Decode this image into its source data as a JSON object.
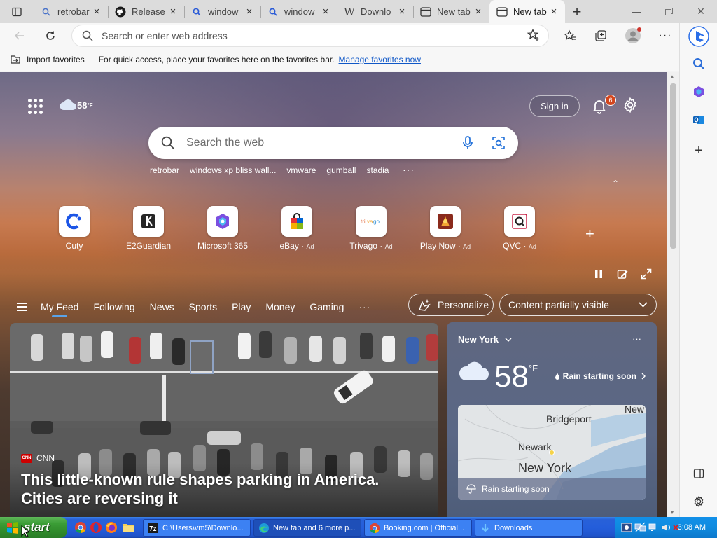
{
  "tabs": [
    {
      "title": "retrobar",
      "icon": "search-icon"
    },
    {
      "title": "Release",
      "icon": "github-icon"
    },
    {
      "title": "window",
      "icon": "search-icon"
    },
    {
      "title": "window",
      "icon": "search-icon"
    },
    {
      "title": "Downlo",
      "icon": "wikipedia-icon"
    },
    {
      "title": "New tab",
      "icon": "newtab-icon"
    },
    {
      "title": "New tab",
      "icon": "newtab-icon",
      "active": true
    }
  ],
  "address": {
    "placeholder": "Search or enter web address"
  },
  "favorites_bar": {
    "import_label": "Import favorites",
    "message": "For quick access, place your favorites here on the favorites bar.",
    "manage_link": "Manage favorites now"
  },
  "top": {
    "weather_temp": "58",
    "weather_unit": "°F",
    "sign_in": "Sign in",
    "notification_count": "6"
  },
  "search": {
    "placeholder": "Search the web",
    "suggestions": [
      "retrobar",
      "windows xp bliss wall...",
      "vmware",
      "gumball",
      "stadia"
    ]
  },
  "quick_links": [
    {
      "name": "Cuty",
      "ad": ""
    },
    {
      "name": "E2Guardian",
      "ad": ""
    },
    {
      "name": "Microsoft 365",
      "ad": ""
    },
    {
      "name": "eBay",
      "ad": "Ad"
    },
    {
      "name": "Trivago",
      "ad": "Ad"
    },
    {
      "name": "Play Now",
      "ad": "Ad"
    },
    {
      "name": "QVC",
      "ad": "Ad"
    }
  ],
  "feed_nav": {
    "items": [
      "My Feed",
      "Following",
      "News",
      "Sports",
      "Play",
      "Money",
      "Gaming"
    ],
    "selected": "My Feed",
    "personalize": "Personalize",
    "visibility": "Content partially visible"
  },
  "hero": {
    "source": "CNN",
    "title": "This little-known rule shapes parking in America. Cities are reversing it"
  },
  "weather_card": {
    "city": "New York",
    "temp": "58",
    "unit": "°F",
    "alert": "Rain starting soon",
    "map_labels": [
      "New",
      "Bridgeport",
      "Newark",
      "New York"
    ],
    "map_alert": "Rain starting soon"
  },
  "taskbar": {
    "start": "start",
    "buttons": [
      {
        "label": "C:\\Users\\vm5\\Downlo...",
        "icon": "sevenzip-icon"
      },
      {
        "label": "New tab and 6 more p...",
        "icon": "edge-icon"
      },
      {
        "label": "Booking.com | Official...",
        "icon": "chrome-icon"
      },
      {
        "label": "Downloads",
        "icon": "download-icon"
      }
    ],
    "clock": "3:08 AM"
  }
}
